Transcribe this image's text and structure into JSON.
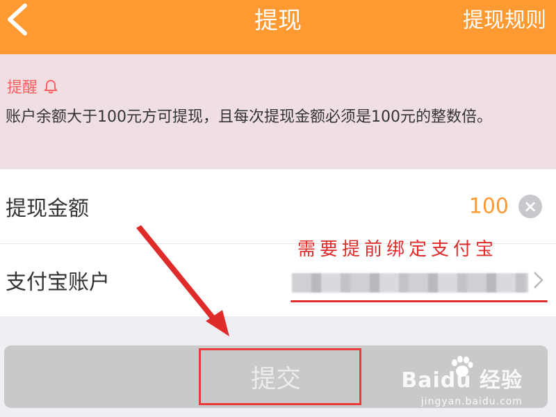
{
  "header": {
    "title": "提现",
    "rules_link": "提现规则"
  },
  "reminder": {
    "title": "提醒",
    "text": "账户余额大于100元方可提现，且每次提现金额必须是100元的整数倍。"
  },
  "form": {
    "amount_label": "提现金额",
    "amount_value": "100",
    "account_label": "支付宝账户"
  },
  "annotation": "需要提前绑定支付宝",
  "submit_label": "提交",
  "watermark": {
    "brand": "Baidu 经验",
    "site": "jingyan.baidu.com"
  },
  "colors": {
    "header": "#ff9a32",
    "reminder_bg": "#efdfe3",
    "alert": "#ff5f5f",
    "annotation": "#e02b2b"
  },
  "icons": [
    "back-chevron-icon",
    "bell-icon",
    "clear-icon",
    "chevron-right-icon",
    "baidu-paw-icon"
  ]
}
